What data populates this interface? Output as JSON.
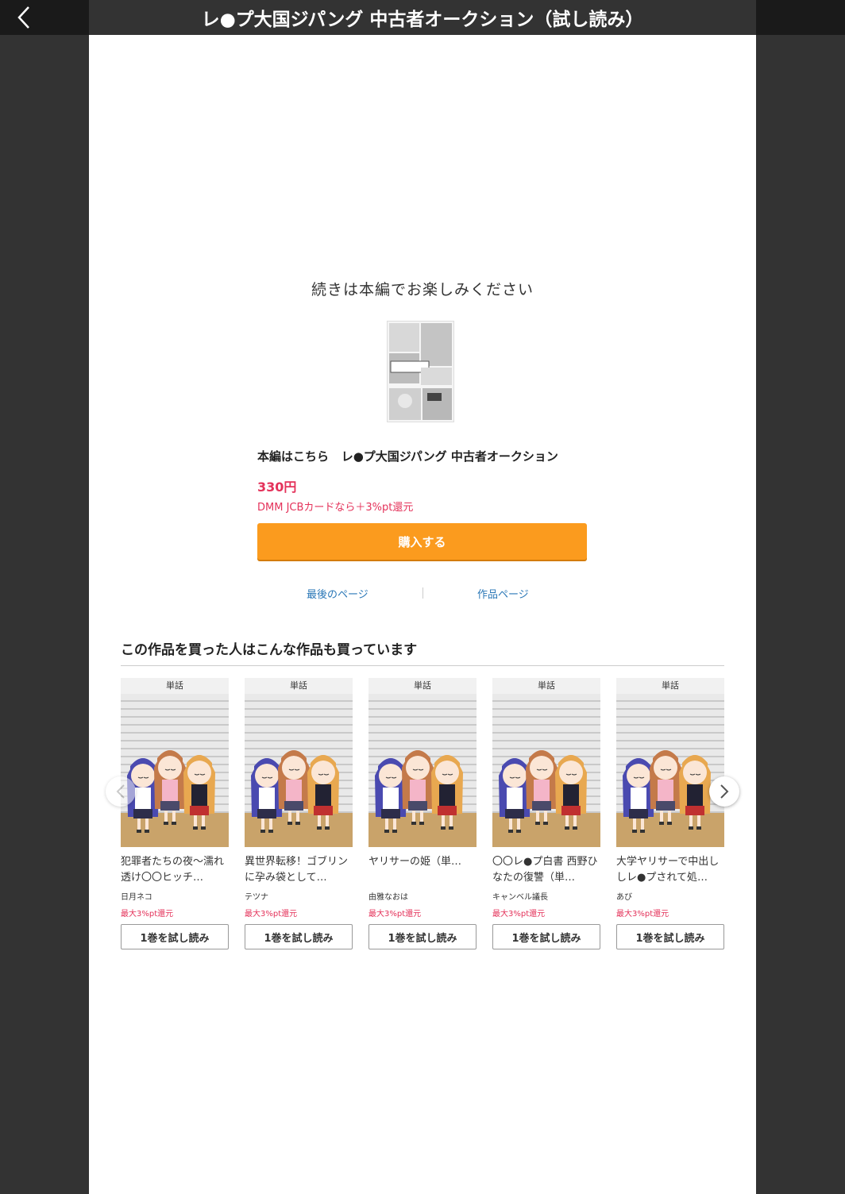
{
  "header": {
    "title": "レ●プ大国ジパング 中古者オークション（試し読み）",
    "back_icon": "chevron-left-icon"
  },
  "end_section": {
    "continue_text": "続きは本編でお楽しみください",
    "product_prefix": "本編はこちら",
    "product_title": "レ●プ大国ジパング 中古者オークション",
    "price": "330円",
    "campaign": "DMM JCBカードなら＋3%pt還元",
    "buy_label": "購入する",
    "last_page_link": "最後のページ",
    "work_page_link": "作品ページ"
  },
  "recommendations": {
    "heading": "この作品を買った人はこんな作品も買っています",
    "items": [
      {
        "badge": "単話",
        "title": "犯罪者たちの夜〜濡れ透け〇〇ヒッチ…",
        "author": "日月ネコ",
        "point": "最大3%pt還元",
        "button": "1巻を試し読み"
      },
      {
        "badge": "単話",
        "title": "異世界転移！ゴブリンに孕み袋として…",
        "author": "テツナ",
        "point": "最大3%pt還元",
        "button": "1巻を試し読み"
      },
      {
        "badge": "単話",
        "title": "ヤリサーの姫（単…",
        "author": "由雅なおは",
        "point": "最大3%pt還元",
        "button": "1巻を試し読み"
      },
      {
        "badge": "単話",
        "title": "〇〇レ●プ白書 西野ひなたの復讐（単…",
        "author": "キャンベル議長",
        "point": "最大3%pt還元",
        "button": "1巻を試し読み"
      },
      {
        "badge": "単話",
        "title": "大学ヤリサーで中出ししレ●プされて処…",
        "author": "あび",
        "point": "最大3%pt還元",
        "button": "1巻を試し読み"
      }
    ]
  },
  "colors": {
    "accent": "#fb9b1e",
    "price": "#e4325a",
    "link": "#2a77b7",
    "frame": "#333333"
  }
}
